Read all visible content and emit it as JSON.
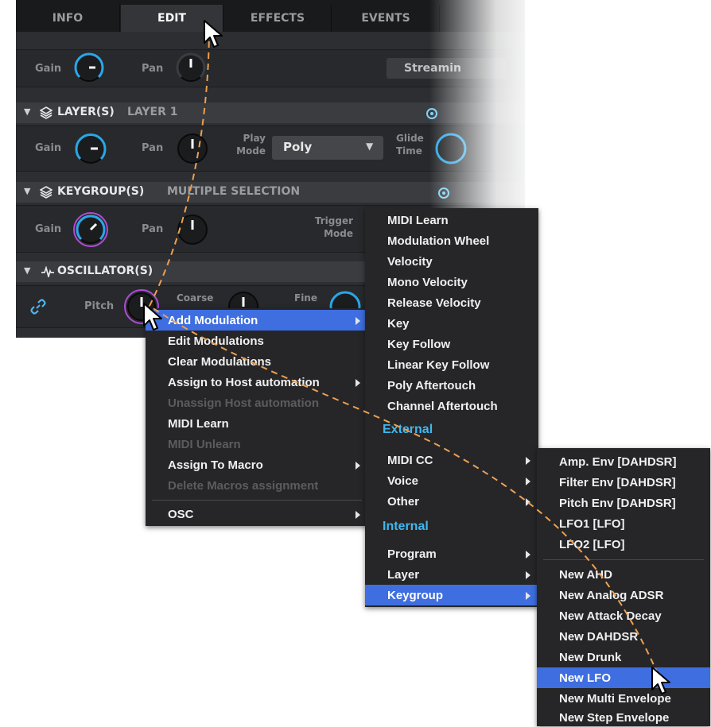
{
  "tabs": [
    {
      "label": "INFO"
    },
    {
      "label": "EDIT"
    },
    {
      "label": "EFFECTS"
    },
    {
      "label": "EVENTS"
    }
  ],
  "program_strip": {
    "gain_label": "Gain",
    "pan_label": "Pan",
    "streaming_label": "Streamin"
  },
  "layer": {
    "header_label": "LAYER(S)",
    "header_value": "LAYER 1",
    "gain_label": "Gain",
    "pan_label": "Pan",
    "play_mode_label_1": "Play",
    "play_mode_label_2": "Mode",
    "play_mode_value": "Poly",
    "glide_label_1": "Glide",
    "glide_label_2": "Time"
  },
  "keygroup": {
    "header_label": "KEYGROUP(S)",
    "header_value": "MULTIPLE SELECTION",
    "gain_label": "Gain",
    "pan_label": "Pan",
    "trigger_label_1": "Trigger",
    "trigger_label_2": "Mode"
  },
  "oscillator": {
    "header_label": "OSCILLATOR(S)",
    "pitch_label": "Pitch",
    "coarse_label": "Coarse",
    "fine_label": "Fine"
  },
  "context_menu": [
    {
      "label": "Add Modulation",
      "submenu": true,
      "state": "selected"
    },
    {
      "label": "Edit Modulations",
      "submenu": false,
      "state": "normal"
    },
    {
      "label": "Clear Modulations",
      "submenu": false,
      "state": "normal"
    },
    {
      "label": "Assign to Host automation",
      "submenu": true,
      "state": "normal"
    },
    {
      "label": "Unassign Host automation",
      "submenu": false,
      "state": "disabled"
    },
    {
      "label": "MIDI Learn",
      "submenu": false,
      "state": "normal"
    },
    {
      "label": "MIDI Unlearn",
      "submenu": false,
      "state": "disabled"
    },
    {
      "label": "Assign To Macro",
      "submenu": true,
      "state": "normal"
    },
    {
      "label": "Delete Macros assignment",
      "submenu": false,
      "state": "disabled"
    },
    {
      "label": "OSC",
      "submenu": true,
      "state": "normal"
    }
  ],
  "modulation_menu": {
    "sources": [
      "MIDI Learn",
      "Modulation Wheel",
      "Velocity",
      "Mono Velocity",
      "Release Velocity",
      "Key",
      "Key Follow",
      "Linear Key Follow",
      "Poly Aftertouch",
      "Channel Aftertouch"
    ],
    "external_heading": "External",
    "external": [
      "MIDI CC",
      "Voice",
      "Other"
    ],
    "internal_heading": "Internal",
    "internal": [
      "Program",
      "Layer",
      "Keygroup"
    ],
    "selected": "Keygroup"
  },
  "keygroup_menu": {
    "existing": [
      "Amp. Env [DAHDSR]",
      "Filter Env [DAHDSR]",
      "Pitch Env [DAHDSR]",
      "LFO1 [LFO]",
      "LFO2 [LFO]"
    ],
    "new": [
      "New AHD",
      "New Analog ADSR",
      "New Attack Decay",
      "New DAHDSR",
      "New Drunk",
      "New LFO",
      "New Multi Envelope",
      "New Step Envelope"
    ],
    "selected": "New LFO"
  },
  "colors": {
    "accent_blue": "#3fb8f0",
    "selection": "#3e6ee0",
    "keygroup_knob_ring": "#b04ad8",
    "path_line": "#f0a050"
  },
  "icons": [
    "layers-icon",
    "waveform-icon",
    "link-icon",
    "mouse-pointer-icon",
    "disclosure-triangle-icon"
  ]
}
